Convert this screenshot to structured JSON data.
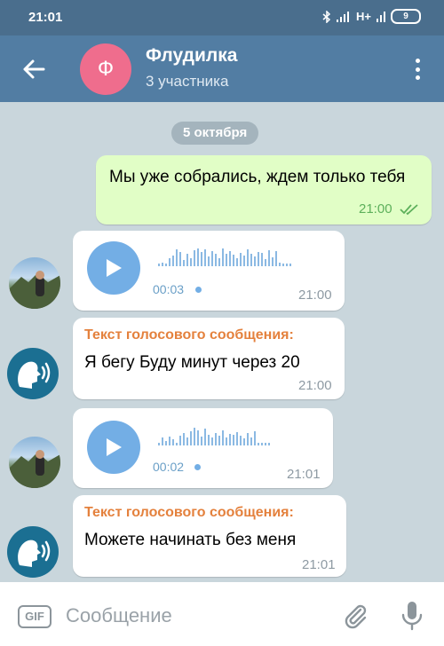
{
  "status": {
    "time": "21:01",
    "network": "H+",
    "battery": "9"
  },
  "header": {
    "avatar_letter": "Ф",
    "title": "Флудилка",
    "subtitle": "3 участника"
  },
  "date_chip": "5 октября",
  "messages": [
    {
      "text": "Мы уже собрались, ждем только тебя",
      "time": "21:00"
    },
    {
      "duration": "00:03",
      "time": "21:00"
    },
    {
      "label": "Текст голосового сообщения:",
      "text": "Я бегу Буду минут через 20",
      "time": "21:00"
    },
    {
      "duration": "00:02",
      "time": "21:01"
    },
    {
      "label": "Текст голосового сообщения:",
      "text": "Можете начинать без меня",
      "time": "21:01"
    }
  ],
  "composer": {
    "gif_label": "GIF",
    "placeholder": "Сообщение"
  },
  "colors": {
    "header": "#527da3",
    "statusbar": "#4a6e8d",
    "outgoing": "#e1fec6",
    "accent": "#73aee5",
    "label": "#e4813d"
  }
}
